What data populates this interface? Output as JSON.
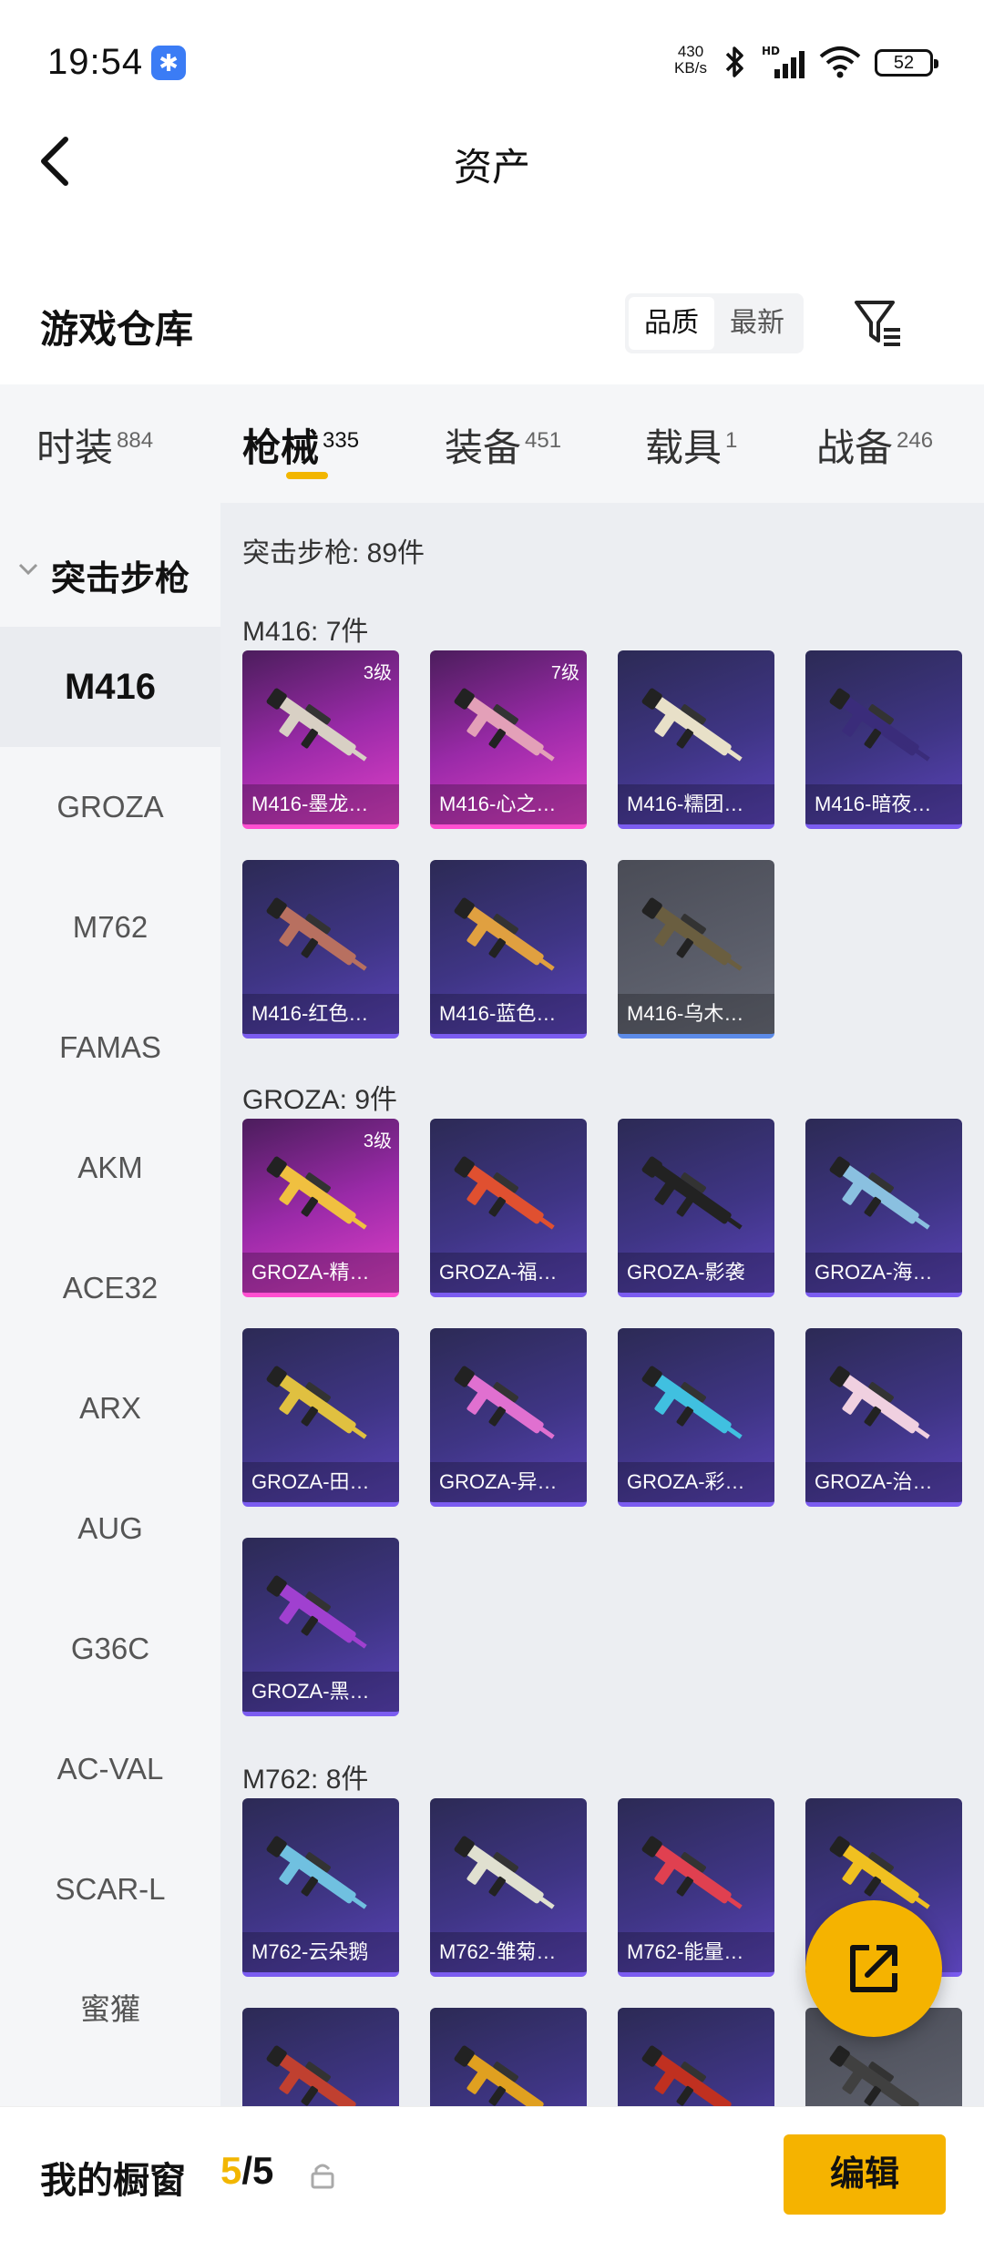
{
  "status_bar": {
    "time": "19:54",
    "net_speed_value": "430",
    "net_speed_unit": "KB/s",
    "battery": "52"
  },
  "header": {
    "title": "资产"
  },
  "section": {
    "title": "游戏仓库",
    "sort_options": [
      "品质",
      "最新"
    ],
    "sort_selected": "品质"
  },
  "tabs": [
    {
      "label": "时装",
      "count": "884"
    },
    {
      "label": "枪械",
      "count": "335"
    },
    {
      "label": "装备",
      "count": "451"
    },
    {
      "label": "载具",
      "count": "1"
    },
    {
      "label": "战备",
      "count": "246"
    }
  ],
  "active_tab": "枪械",
  "sidebar": {
    "group": "突击步枪",
    "items": [
      "M416",
      "GROZA",
      "M762",
      "FAMAS",
      "AKM",
      "ACE32",
      "ARX",
      "AUG",
      "G36C",
      "AC-VAL",
      "SCAR-L",
      "蜜獾"
    ],
    "selected": "M416"
  },
  "content": {
    "summary": "突击步枪: 89件",
    "groups": [
      {
        "heading": "M416: 7件",
        "items": [
          {
            "name": "M416-墨龙…",
            "level": "3级",
            "rarity": "pink"
          },
          {
            "name": "M416-心之…",
            "level": "7级",
            "rarity": "pink"
          },
          {
            "name": "M416-糯团…",
            "level": "",
            "rarity": "purple"
          },
          {
            "name": "M416-暗夜…",
            "level": "",
            "rarity": "purple"
          },
          {
            "name": "M416-红色…",
            "level": "",
            "rarity": "purple"
          },
          {
            "name": "M416-蓝色…",
            "level": "",
            "rarity": "purple"
          },
          {
            "name": "M416-乌木…",
            "level": "",
            "rarity": "gray"
          }
        ]
      },
      {
        "heading": "GROZA: 9件",
        "items": [
          {
            "name": "GROZA-精…",
            "level": "3级",
            "rarity": "pink"
          },
          {
            "name": "GROZA-福…",
            "level": "",
            "rarity": "purple"
          },
          {
            "name": "GROZA-影袭",
            "level": "",
            "rarity": "purple"
          },
          {
            "name": "GROZA-海…",
            "level": "",
            "rarity": "purple"
          },
          {
            "name": "GROZA-田…",
            "level": "",
            "rarity": "purple"
          },
          {
            "name": "GROZA-异…",
            "level": "",
            "rarity": "purple"
          },
          {
            "name": "GROZA-彩…",
            "level": "",
            "rarity": "purple"
          },
          {
            "name": "GROZA-治…",
            "level": "",
            "rarity": "purple"
          },
          {
            "name": "GROZA-黑…",
            "level": "",
            "rarity": "purple"
          }
        ]
      },
      {
        "heading": "M762: 8件",
        "items": [
          {
            "name": "M762-云朵鹅",
            "level": "",
            "rarity": "purple"
          },
          {
            "name": "M762-雏菊…",
            "level": "",
            "rarity": "purple"
          },
          {
            "name": "M762-能量…",
            "level": "",
            "rarity": "purple"
          },
          {
            "name": "",
            "level": "",
            "rarity": "purple"
          },
          {
            "name": "",
            "level": "",
            "rarity": "purple"
          },
          {
            "name": "",
            "level": "",
            "rarity": "purple"
          },
          {
            "name": "",
            "level": "",
            "rarity": "purple"
          },
          {
            "name": "",
            "level": "",
            "rarity": "gray"
          }
        ]
      }
    ]
  },
  "bottom_bar": {
    "label": "我的橱窗",
    "used": "5",
    "separator": "/",
    "total": "5",
    "edit_label": "编辑"
  },
  "colors": {
    "accent": "#f5b300",
    "rarity_pink": "#e040c8",
    "rarity_purple": "#5a43b8",
    "rarity_gray": "#5b5e6a"
  }
}
